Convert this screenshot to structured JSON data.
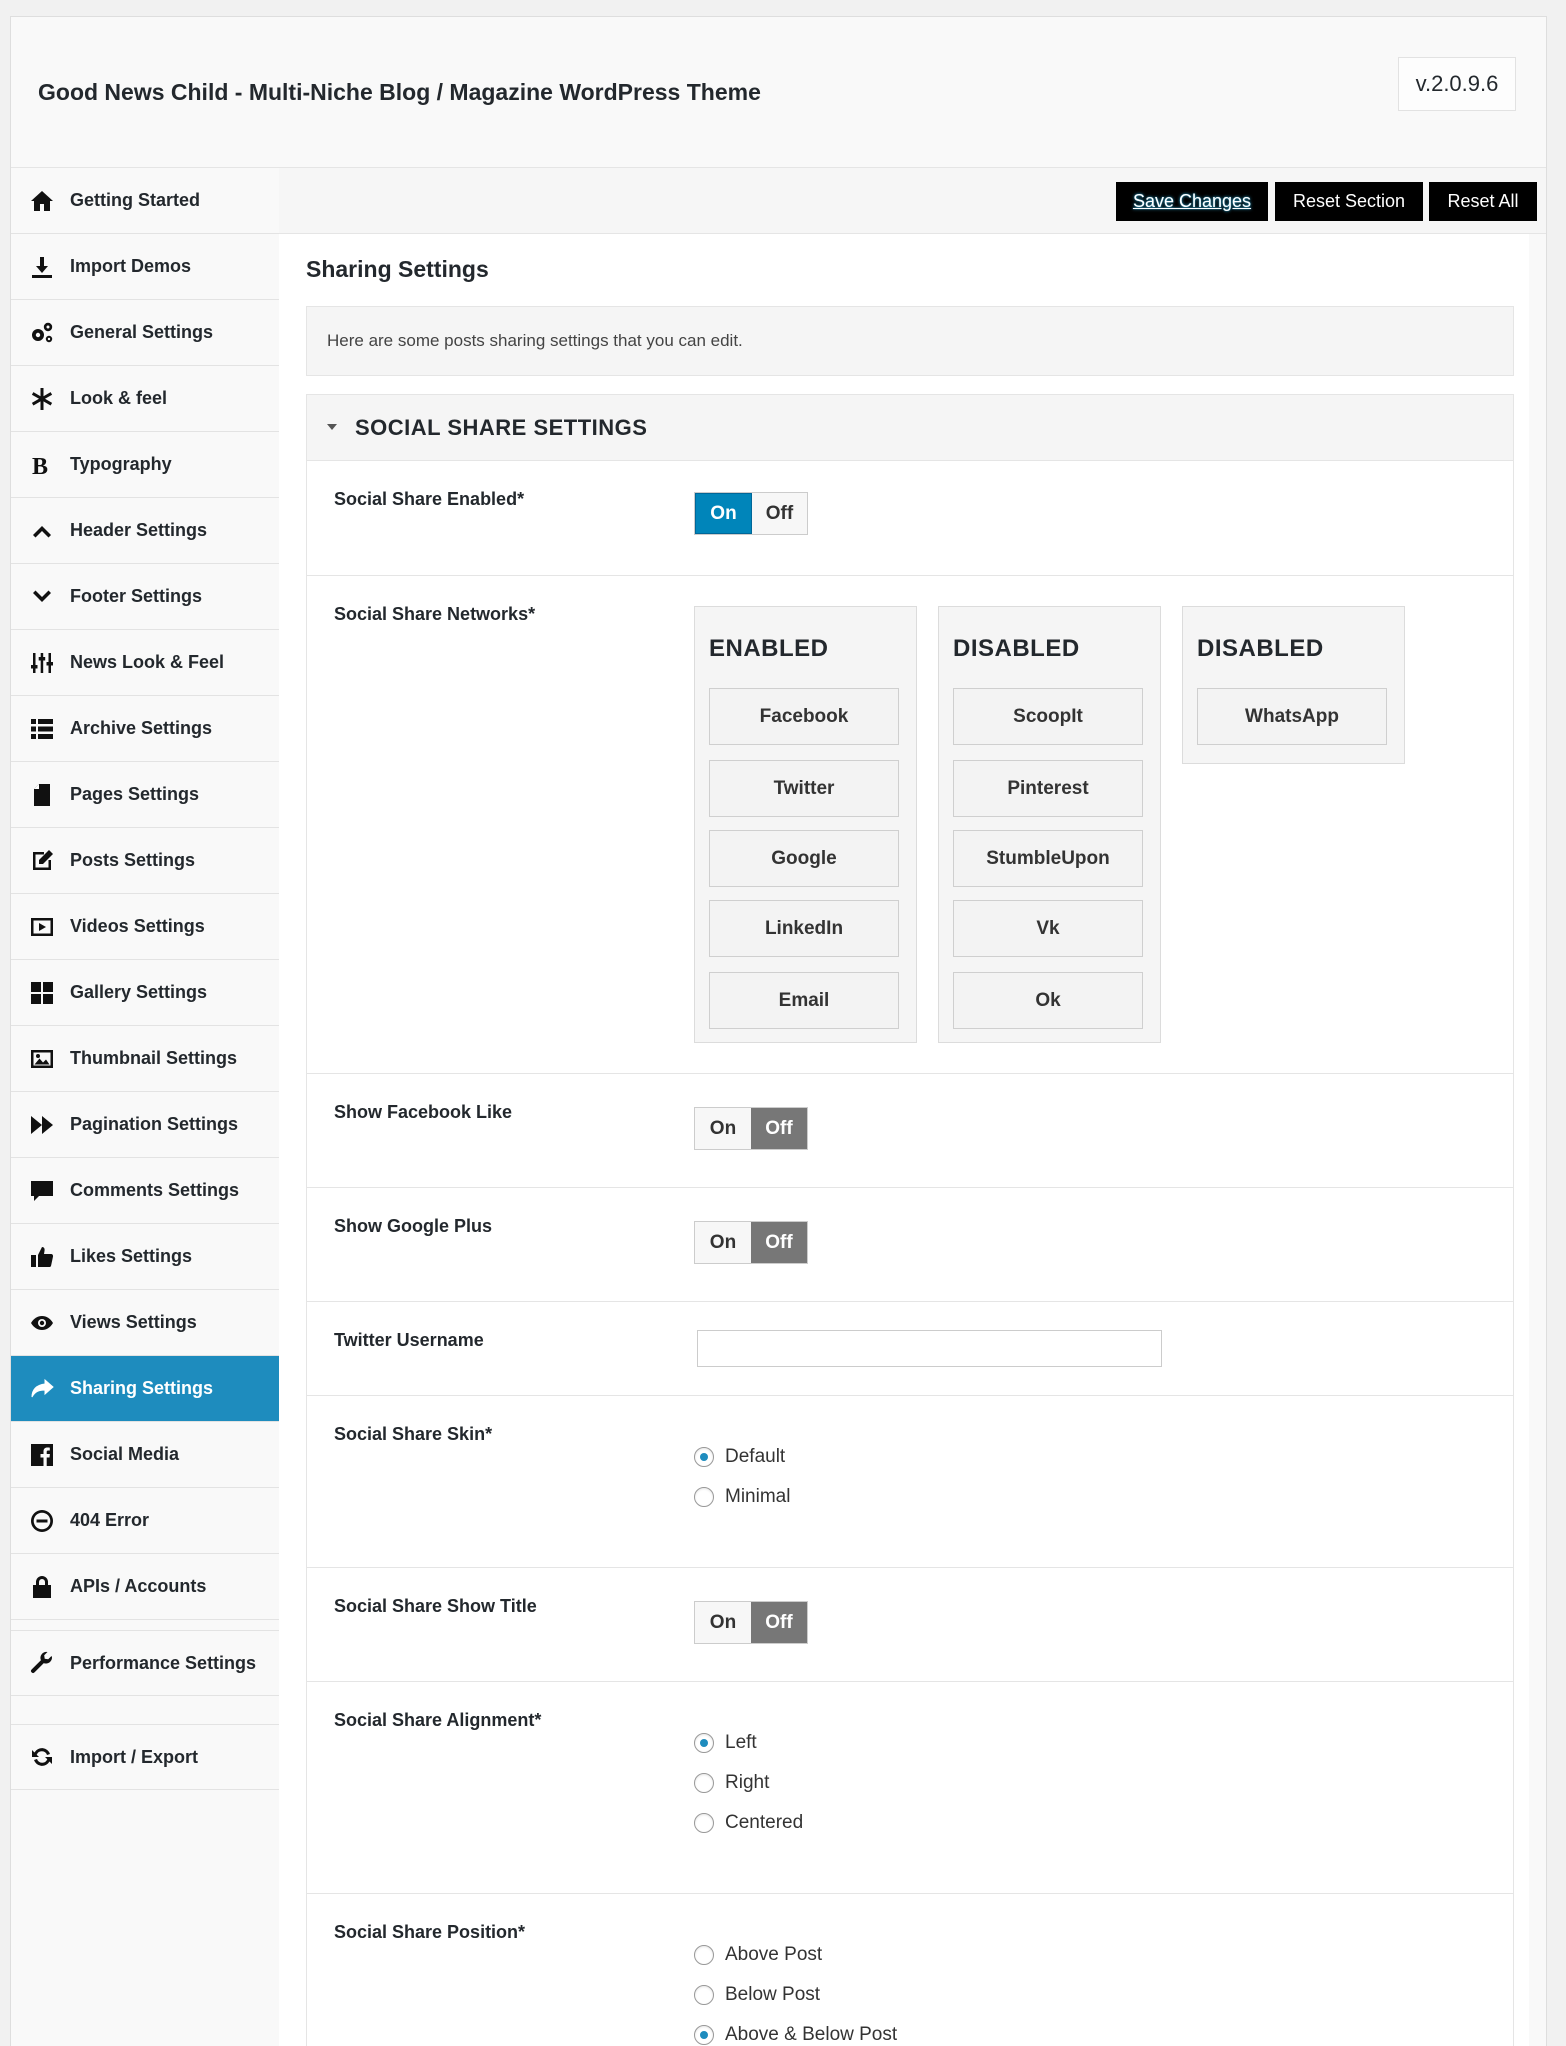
{
  "app": {
    "theme_title": "Good News Child - Multi-Niche Blog / Magazine WordPress Theme",
    "version": "v.2.0.9.6"
  },
  "actions": {
    "save": "Save Changes",
    "reset_section": "Reset Section",
    "reset_all": "Reset All"
  },
  "sidebar": {
    "items": [
      {
        "label": "Getting Started",
        "icon": "home-icon"
      },
      {
        "label": "Import Demos",
        "icon": "download-icon"
      },
      {
        "label": "General Settings",
        "icon": "cogs-icon"
      },
      {
        "label": "Look & feel",
        "icon": "asterisk-icon"
      },
      {
        "label": "Typography",
        "icon": "bold-icon"
      },
      {
        "label": "Header Settings",
        "icon": "chevron-up-icon"
      },
      {
        "label": "Footer Settings",
        "icon": "chevron-down-icon"
      },
      {
        "label": "News Look & Feel",
        "icon": "sliders-icon"
      },
      {
        "label": "Archive Settings",
        "icon": "list-icon"
      },
      {
        "label": "Pages Settings",
        "icon": "page-icon"
      },
      {
        "label": "Posts Settings",
        "icon": "edit-icon"
      },
      {
        "label": "Videos Settings",
        "icon": "video-icon"
      },
      {
        "label": "Gallery Settings",
        "icon": "grid-icon"
      },
      {
        "label": "Thumbnail Settings",
        "icon": "image-icon"
      },
      {
        "label": "Pagination Settings",
        "icon": "fast-forward-icon"
      },
      {
        "label": "Comments Settings",
        "icon": "comment-icon"
      },
      {
        "label": "Likes Settings",
        "icon": "thumbs-up-icon"
      },
      {
        "label": "Views Settings",
        "icon": "eye-icon"
      },
      {
        "label": "Sharing Settings",
        "icon": "share-icon"
      },
      {
        "label": "Social Media",
        "icon": "facebook-icon"
      },
      {
        "label": "404 Error",
        "icon": "minus-circle-icon"
      },
      {
        "label": "APIs / Accounts",
        "icon": "lock-icon"
      },
      {
        "label": "Performance Settings",
        "icon": "wrench-icon"
      },
      {
        "label": "Import / Export",
        "icon": "refresh-icon"
      }
    ],
    "active_index": 18
  },
  "section": {
    "title": "Sharing Settings",
    "description": "Here are some posts sharing settings that you can edit.",
    "group_title": "SOCIAL SHARE SETTINGS"
  },
  "fields": {
    "share_enabled": {
      "label": "Social Share Enabled*",
      "on": "On",
      "off": "Off",
      "value": "on"
    },
    "networks": {
      "label": "Social Share Networks*",
      "columns": [
        {
          "title": "ENABLED",
          "items": [
            "Facebook",
            "Twitter",
            "Google",
            "LinkedIn",
            "Email"
          ]
        },
        {
          "title": "DISABLED",
          "items": [
            "ScoopIt",
            "Pinterest",
            "StumbleUpon",
            "Vk",
            "Ok"
          ]
        },
        {
          "title": "DISABLED",
          "items": [
            "WhatsApp"
          ]
        }
      ]
    },
    "facebook_like": {
      "label": "Show Facebook Like",
      "on": "On",
      "off": "Off",
      "value": "off"
    },
    "google_plus": {
      "label": "Show Google Plus",
      "on": "On",
      "off": "Off",
      "value": "off"
    },
    "twitter_username": {
      "label": "Twitter Username",
      "value": "",
      "placeholder": ""
    },
    "skin": {
      "label": "Social Share Skin*",
      "options": [
        "Default",
        "Minimal"
      ],
      "selected": 0
    },
    "show_title": {
      "label": "Social Share Show Title",
      "on": "On",
      "off": "Off",
      "value": "off"
    },
    "alignment": {
      "label": "Social Share Alignment*",
      "options": [
        "Left",
        "Right",
        "Centered"
      ],
      "selected": 0
    },
    "position": {
      "label": "Social Share Position*",
      "options": [
        "Above Post",
        "Below Post",
        "Above & Below Post"
      ],
      "selected": 2
    }
  },
  "colors": {
    "accent": "#1e8cbe",
    "toggle_on": "#0085ba",
    "toggle_off": "#777777",
    "button_bg": "#000000"
  }
}
